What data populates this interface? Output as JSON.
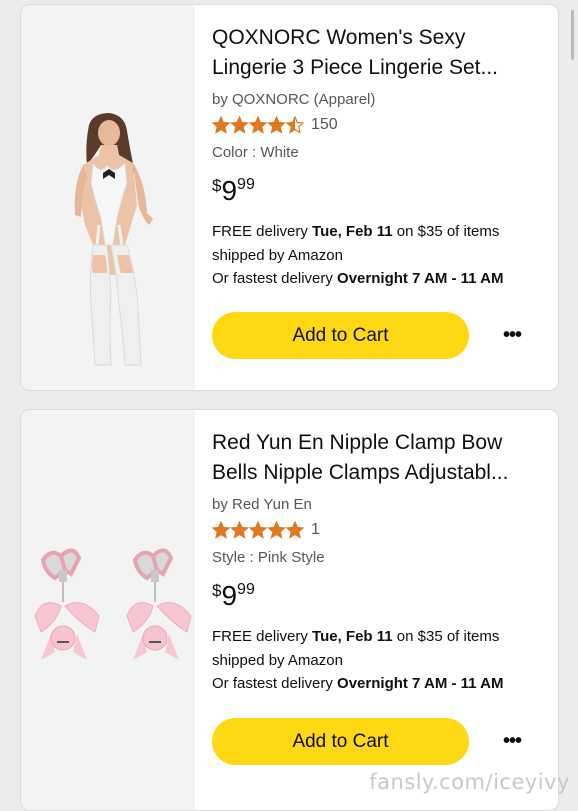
{
  "products": [
    {
      "title_line1": "QOXNORC Women's Sexy",
      "title_line2": "Lingerie 3 Piece Lingerie Set...",
      "byline": "by QOXNORC (Apparel)",
      "rating_stars": 4.5,
      "rating_count": "150",
      "variant": "Color : White",
      "price_symbol": "$",
      "price_whole": "9",
      "price_fraction": "99",
      "ship_line1_pre": "FREE delivery ",
      "ship_line1_bold": "Tue, Feb 11",
      "ship_line1_post": " on $35 of items",
      "ship_line2": "shipped by Amazon",
      "ship_line3_pre": "Or fastest delivery ",
      "ship_line3_bold": "Overnight 7 AM - 11 AM",
      "cart_label": "Add to Cart",
      "more_label": "•••"
    },
    {
      "title_line1": "Red Yun En Nipple Clamp Bow",
      "title_line2": "Bells Nipple Clamps Adjustabl...",
      "byline": "by Red Yun En",
      "rating_stars": 5,
      "rating_count": "1",
      "variant": "Style : Pink Style",
      "price_symbol": "$",
      "price_whole": "9",
      "price_fraction": "99",
      "ship_line1_pre": "FREE delivery ",
      "ship_line1_bold": "Tue, Feb 11",
      "ship_line1_post": " on $35 of items",
      "ship_line2": "shipped by Amazon",
      "ship_line3_pre": "Or fastest delivery ",
      "ship_line3_bold": "Overnight 7 AM - 11 AM",
      "cart_label": "Add to Cart",
      "more_label": "•••"
    }
  ],
  "watermark": "fansly.com/iceyivy",
  "colors": {
    "cart_button": "#ffd814",
    "star": "#de7921",
    "card_image_bg": "#f3f3f3"
  }
}
